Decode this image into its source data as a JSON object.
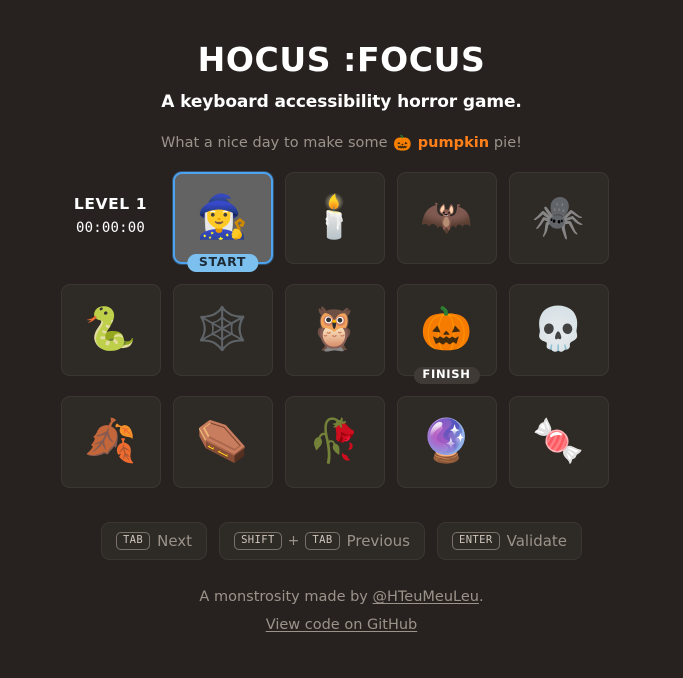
{
  "header": {
    "title": "HOCUS :FOCUS",
    "subtitle": "A keyboard accessibility horror game.",
    "tagline_before": "What a nice day to make some",
    "tagline_emoji": "🎃",
    "tagline_highlight": "pumpkin",
    "tagline_after": "pie!",
    "highlight_color": "#ff7f18"
  },
  "status": {
    "level_label": "LEVEL 1",
    "timer": "00:00:00"
  },
  "grid": {
    "columns": 5,
    "rows": 3,
    "focused_index": 0,
    "tiles": [
      {
        "icon_name": "mage-icon",
        "glyph": "🧙‍♀️",
        "badge": "START",
        "badge_type": "start",
        "focused": true
      },
      {
        "icon_name": "candle-icon",
        "glyph": "🕯️",
        "badge": "",
        "badge_type": "",
        "focused": false
      },
      {
        "icon_name": "bat-icon",
        "glyph": "🦇",
        "badge": "",
        "badge_type": "",
        "focused": false
      },
      {
        "icon_name": "spider-icon",
        "glyph": "🕷️",
        "badge": "",
        "badge_type": "",
        "focused": false
      },
      {
        "icon_name": "snake-icon",
        "glyph": "🐍",
        "badge": "",
        "badge_type": "",
        "focused": false
      },
      {
        "icon_name": "spider-web-icon",
        "glyph": "🕸️",
        "badge": "",
        "badge_type": "",
        "focused": false
      },
      {
        "icon_name": "owl-icon",
        "glyph": "🦉",
        "badge": "",
        "badge_type": "",
        "focused": false
      },
      {
        "icon_name": "jack-o-lantern-icon",
        "glyph": "🎃",
        "badge": "FINISH",
        "badge_type": "finish",
        "focused": false
      },
      {
        "icon_name": "skull-icon",
        "glyph": "💀",
        "badge": "",
        "badge_type": "",
        "focused": false
      },
      {
        "icon_name": "fallen-leaf-icon",
        "glyph": "🍂",
        "badge": "",
        "badge_type": "",
        "focused": false
      },
      {
        "icon_name": "coffin-icon",
        "glyph": "⚰️",
        "badge": "",
        "badge_type": "",
        "focused": false
      },
      {
        "icon_name": "wilted-flower-icon",
        "glyph": "🥀",
        "badge": "",
        "badge_type": "",
        "focused": false
      },
      {
        "icon_name": "crystal-ball-icon",
        "glyph": "🔮",
        "badge": "",
        "badge_type": "",
        "focused": false
      },
      {
        "icon_name": "candy-corn-icon",
        "glyph": "🍬",
        "badge": "",
        "badge_type": "",
        "focused": false
      }
    ]
  },
  "hints": [
    {
      "keys": [
        "TAB"
      ],
      "separator": "",
      "label": "Next"
    },
    {
      "keys": [
        "SHIFT",
        "TAB"
      ],
      "separator": "+",
      "label": "Previous"
    },
    {
      "keys": [
        "ENTER"
      ],
      "separator": "",
      "label": "Validate"
    }
  ],
  "footer": {
    "credit_before": "A monstrosity made by",
    "credit_link": "@HTeuMeuLeu",
    "credit_after": ".",
    "source_link": "View code on GitHub"
  },
  "theme": {
    "background": "#272220",
    "tile_background": "#2e2a26",
    "tile_border": "#3b3631",
    "focus_fill": "#636363",
    "focus_border": "#4da3f0",
    "start_badge": "#7cc0f0",
    "finish_badge": "#3f3a36",
    "muted_text": "#9b9289",
    "accent": "#ff7f18"
  }
}
